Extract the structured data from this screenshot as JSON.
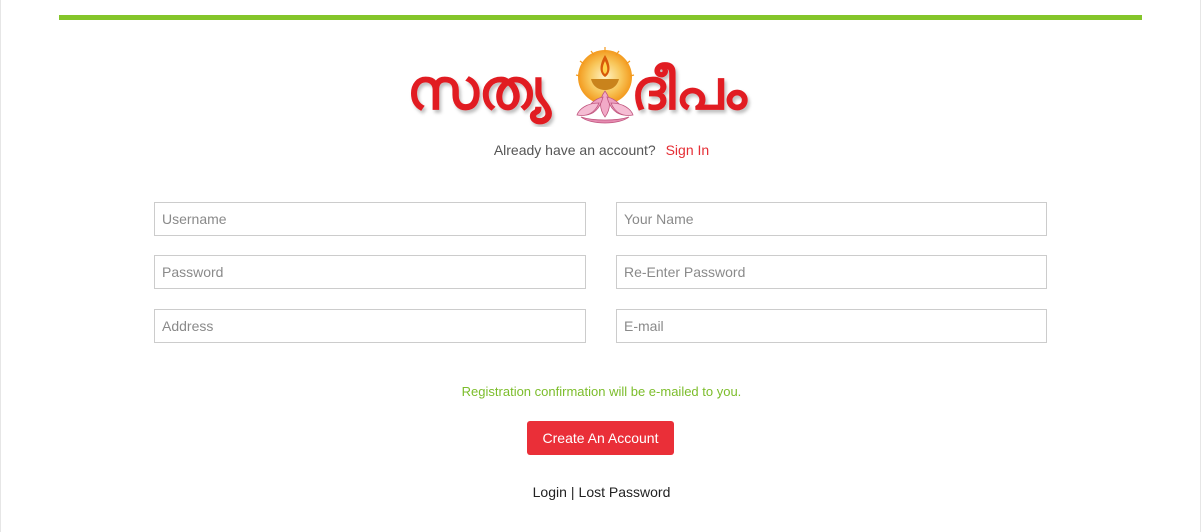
{
  "brand": {
    "logo_text_left": "സത്യ",
    "logo_text_right": "ദീപം",
    "colors": {
      "logo_red": "#e11b22",
      "accent_green": "#84c52a",
      "button_red": "#ea2f38",
      "link_red": "#e52e35",
      "lamp_orange": "#f39a1e",
      "lotus_pink": "#e58ab0"
    },
    "icon": "oil-lamp-lotus-icon"
  },
  "signin": {
    "prompt": "Already have an account?",
    "link": "Sign In"
  },
  "form": {
    "username_placeholder": "Username",
    "name_placeholder": "Your Name",
    "password_placeholder": "Password",
    "repassword_placeholder": "Re-Enter Password",
    "address_placeholder": "Address",
    "email_placeholder": "E-mail"
  },
  "notice": "Registration confirmation will be e-mailed to you.",
  "create_button": "Create An Account",
  "footer": {
    "login": "Login",
    "separator": "|",
    "lost_password": "Lost Password"
  }
}
